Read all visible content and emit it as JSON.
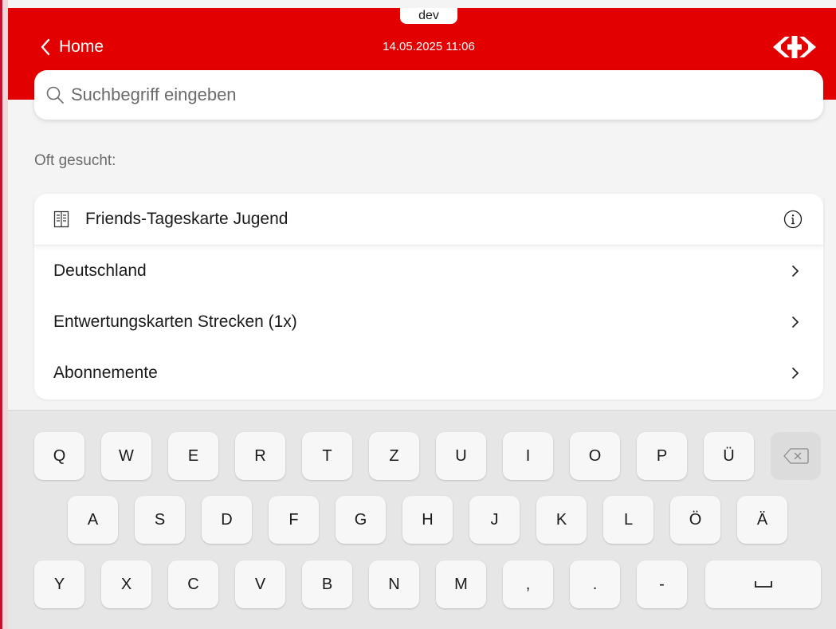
{
  "env_badge": "dev",
  "header": {
    "back_label": "Home",
    "datetime": "14.05.2025 11:06",
    "logo_icon": "sbb-logo-icon",
    "color": "#e30000"
  },
  "search": {
    "placeholder": "Suchbegriff eingeben",
    "value": "",
    "icon": "search-icon"
  },
  "frequent": {
    "title": "Oft gesucht:",
    "featured": {
      "label": "Friends-Tageskarte Jugend",
      "icon": "ticket-icon",
      "info_icon": "info-icon"
    },
    "categories": [
      {
        "label": "Deutschland"
      },
      {
        "label": "Entwertungskarten Strecken (1x)"
      },
      {
        "label": "Abonnemente"
      }
    ]
  },
  "keyboard": {
    "row1": [
      "Q",
      "W",
      "E",
      "R",
      "T",
      "Z",
      "U",
      "I",
      "O",
      "P",
      "Ü"
    ],
    "row2": [
      "A",
      "S",
      "D",
      "F",
      "G",
      "H",
      "J",
      "K",
      "L",
      "Ö",
      "Ä"
    ],
    "row3": [
      "Y",
      "X",
      "C",
      "V",
      "B",
      "N",
      "M",
      ",",
      ".",
      "-"
    ],
    "backspace_icon": "backspace-icon",
    "space_icon": "space-bar-icon"
  }
}
